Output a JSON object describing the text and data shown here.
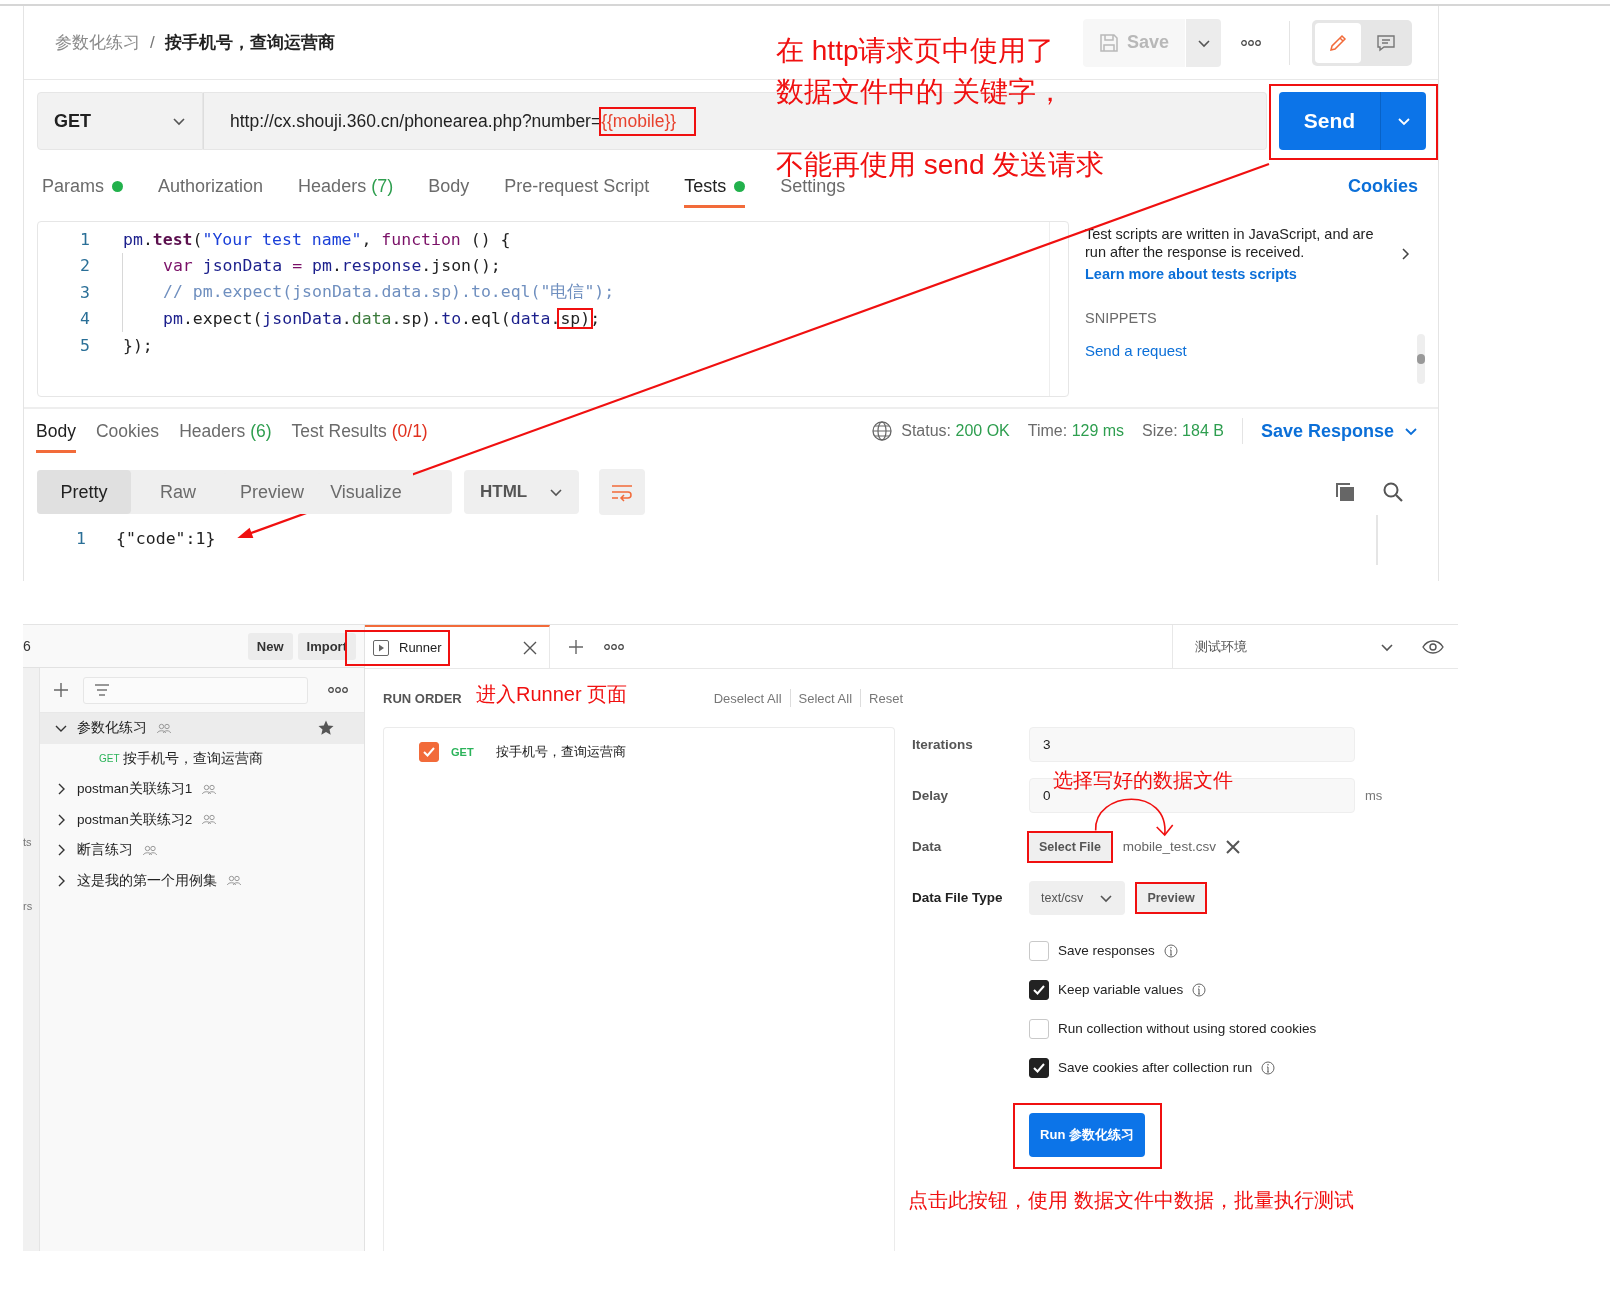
{
  "request_view": {
    "breadcrumb": {
      "collection": "参数化练习",
      "separator": "/",
      "request": "按手机号，查询运营商"
    },
    "save_button": {
      "label": "Save",
      "disabled": true
    },
    "view_modes": [
      {
        "kind": "edit",
        "selected": true
      },
      {
        "kind": "comment",
        "selected": false
      }
    ],
    "request": {
      "method": "GET",
      "url_base": "http://cx.shouji.360.cn/phonearea.php?number=",
      "url_variable": "{{mobile}}",
      "url_variable_highlighted": true
    },
    "send_button": {
      "label": "Send",
      "highlighted": true
    },
    "tabs": [
      {
        "label": "Params",
        "dot": true,
        "selected": false
      },
      {
        "label": "Authorization",
        "dot": false,
        "selected": false
      },
      {
        "label": "Headers",
        "count": "(7)",
        "dot": false,
        "selected": false
      },
      {
        "label": "Body",
        "dot": false,
        "selected": false
      },
      {
        "label": "Pre-request Script",
        "dot": false,
        "selected": false
      },
      {
        "label": "Tests",
        "dot": true,
        "selected": true
      },
      {
        "label": "Settings",
        "dot": false,
        "selected": false
      }
    ],
    "cookies_link": "Cookies",
    "code": [
      {
        "number": "1",
        "indented": false,
        "tokens": [
          {
            "text": "pm",
            "kind": "var"
          },
          {
            "text": ".",
            "kind": "plain"
          },
          {
            "text": "test",
            "kind": "fn"
          },
          {
            "text": "(",
            "kind": "plain"
          },
          {
            "text": "\"Your test name\"",
            "kind": "str"
          },
          {
            "text": ", ",
            "kind": "plain"
          },
          {
            "text": "function",
            "kind": "kw"
          },
          {
            "text": " () {",
            "kind": "plain"
          }
        ]
      },
      {
        "number": "2",
        "indented": true,
        "tokens": [
          {
            "text": "var",
            "kind": "kw"
          },
          {
            "text": " jsonData",
            "kind": "var"
          },
          {
            "text": " = ",
            "kind": "kw"
          },
          {
            "text": "pm",
            "kind": "var"
          },
          {
            "text": ".",
            "kind": "plain"
          },
          {
            "text": "response",
            "kind": "var"
          },
          {
            "text": ".json();",
            "kind": "plain"
          }
        ]
      },
      {
        "number": "3",
        "indented": true,
        "tokens": [
          {
            "text": "// pm.expect(jsonData.data.sp).to.eql(\"电信\");",
            "kind": "comment"
          }
        ]
      },
      {
        "number": "4",
        "indented": true,
        "tokens": [
          {
            "text": "pm",
            "kind": "var"
          },
          {
            "text": ".expect(",
            "kind": "plain"
          },
          {
            "text": "jsonData",
            "kind": "var"
          },
          {
            "text": ".",
            "kind": "plain"
          },
          {
            "text": "data",
            "kind": "prop"
          },
          {
            "text": ".sp).",
            "kind": "plain"
          },
          {
            "text": "to",
            "kind": "var"
          },
          {
            "text": ".eql(",
            "kind": "plain"
          },
          {
            "text": "data",
            "kind": "var"
          },
          {
            "text": ".",
            "kind": "plain"
          },
          {
            "text": "sp)",
            "kind": "marked"
          },
          {
            "text": ";",
            "kind": "plain"
          }
        ]
      },
      {
        "number": "5",
        "indented": false,
        "tokens": [
          {
            "text": "});",
            "kind": "plain"
          }
        ]
      }
    ],
    "help": {
      "text": "Test scripts are written in JavaScript, and are run after the response is received.",
      "link": "Learn more about tests scripts",
      "snippets_heading": "SNIPPETS",
      "snippets": [
        "Send a request"
      ]
    },
    "response": {
      "tabs": [
        {
          "label": "Body",
          "selected": true
        },
        {
          "label": "Cookies",
          "selected": false
        },
        {
          "label": "Headers",
          "count": "(6)",
          "color": "#2e9e4f",
          "selected": false
        },
        {
          "label": "Test Results",
          "count": "(0/1)",
          "color": "#e0301e",
          "selected": false
        }
      ],
      "stats": [
        {
          "label": "Status:",
          "value": "200 OK"
        },
        {
          "label": "Time:",
          "value": "129 ms"
        },
        {
          "label": "Size:",
          "value": "184 B"
        }
      ],
      "save_response": "Save Response",
      "formats": [
        {
          "label": "Pretty",
          "selected": true
        },
        {
          "label": "Raw",
          "selected": false
        },
        {
          "label": "Preview",
          "selected": false
        },
        {
          "label": "Visualize",
          "selected": false
        }
      ],
      "language": "HTML",
      "body_lines": [
        {
          "number": "1",
          "text": "{\"code\":1}"
        }
      ]
    }
  },
  "runner_view": {
    "sidebar": {
      "header_fragment": "6",
      "rail_fragments": [
        "ts",
        "rs"
      ],
      "new_button": "New",
      "import_button": "Import",
      "collections": [
        {
          "name": "参数化练习",
          "expanded": true,
          "selected": true,
          "starred": true,
          "children": [
            {
              "method": "GET",
              "name": "按手机号，查询运营商"
            }
          ]
        },
        {
          "name": "postman关联练习1",
          "expanded": false,
          "selected": false,
          "starred": false
        },
        {
          "name": "postman关联练习2",
          "expanded": false,
          "selected": false,
          "starred": false
        },
        {
          "name": "断言练习",
          "expanded": false,
          "selected": false,
          "starred": false
        },
        {
          "name": "这是我的第一个用例集",
          "expanded": false,
          "selected": false,
          "starred": false
        }
      ]
    },
    "tab": {
      "label": "Runner",
      "highlighted": true
    },
    "environment": "测试环境",
    "run_order": {
      "heading": "RUN ORDER",
      "actions": [
        "Deselect All",
        "Select All",
        "Reset"
      ],
      "items": [
        {
          "method": "GET",
          "name": "按手机号，查询运营商",
          "checked": true
        }
      ]
    },
    "settings": {
      "iterations": {
        "label": "Iterations",
        "value": "3"
      },
      "delay": {
        "label": "Delay",
        "value": "0",
        "unit": "ms"
      },
      "data": {
        "label": "Data",
        "button": "Select File",
        "button_highlighted": true,
        "file": "mobile_test.csv"
      },
      "file_type": {
        "label": "Data File Type",
        "value": "text/csv",
        "preview": "Preview",
        "preview_highlighted": true
      },
      "options": [
        {
          "label": "Save responses",
          "checked": false,
          "info": true
        },
        {
          "label": "Keep variable values",
          "checked": true,
          "info": true
        },
        {
          "label": "Run collection without using stored cookies",
          "checked": false,
          "info": false
        },
        {
          "label": "Save cookies after collection run",
          "checked": true,
          "info": true
        }
      ],
      "run_button": {
        "label": "Run 参数化练习",
        "highlighted": true
      }
    }
  },
  "annotations": [
    {
      "kind": "note",
      "text": "在 http请求页中使用了"
    },
    {
      "kind": "note",
      "text": "数据文件中的 关键字，"
    },
    {
      "kind": "note",
      "text": "不能再使用 send 发送请求"
    },
    {
      "kind": "note",
      "text": "进入Runner 页面"
    },
    {
      "kind": "note",
      "text": "选择写好的数据文件"
    },
    {
      "kind": "note",
      "text": "点击此按钮，使用 数据文件中数据，批量执行测试"
    }
  ]
}
